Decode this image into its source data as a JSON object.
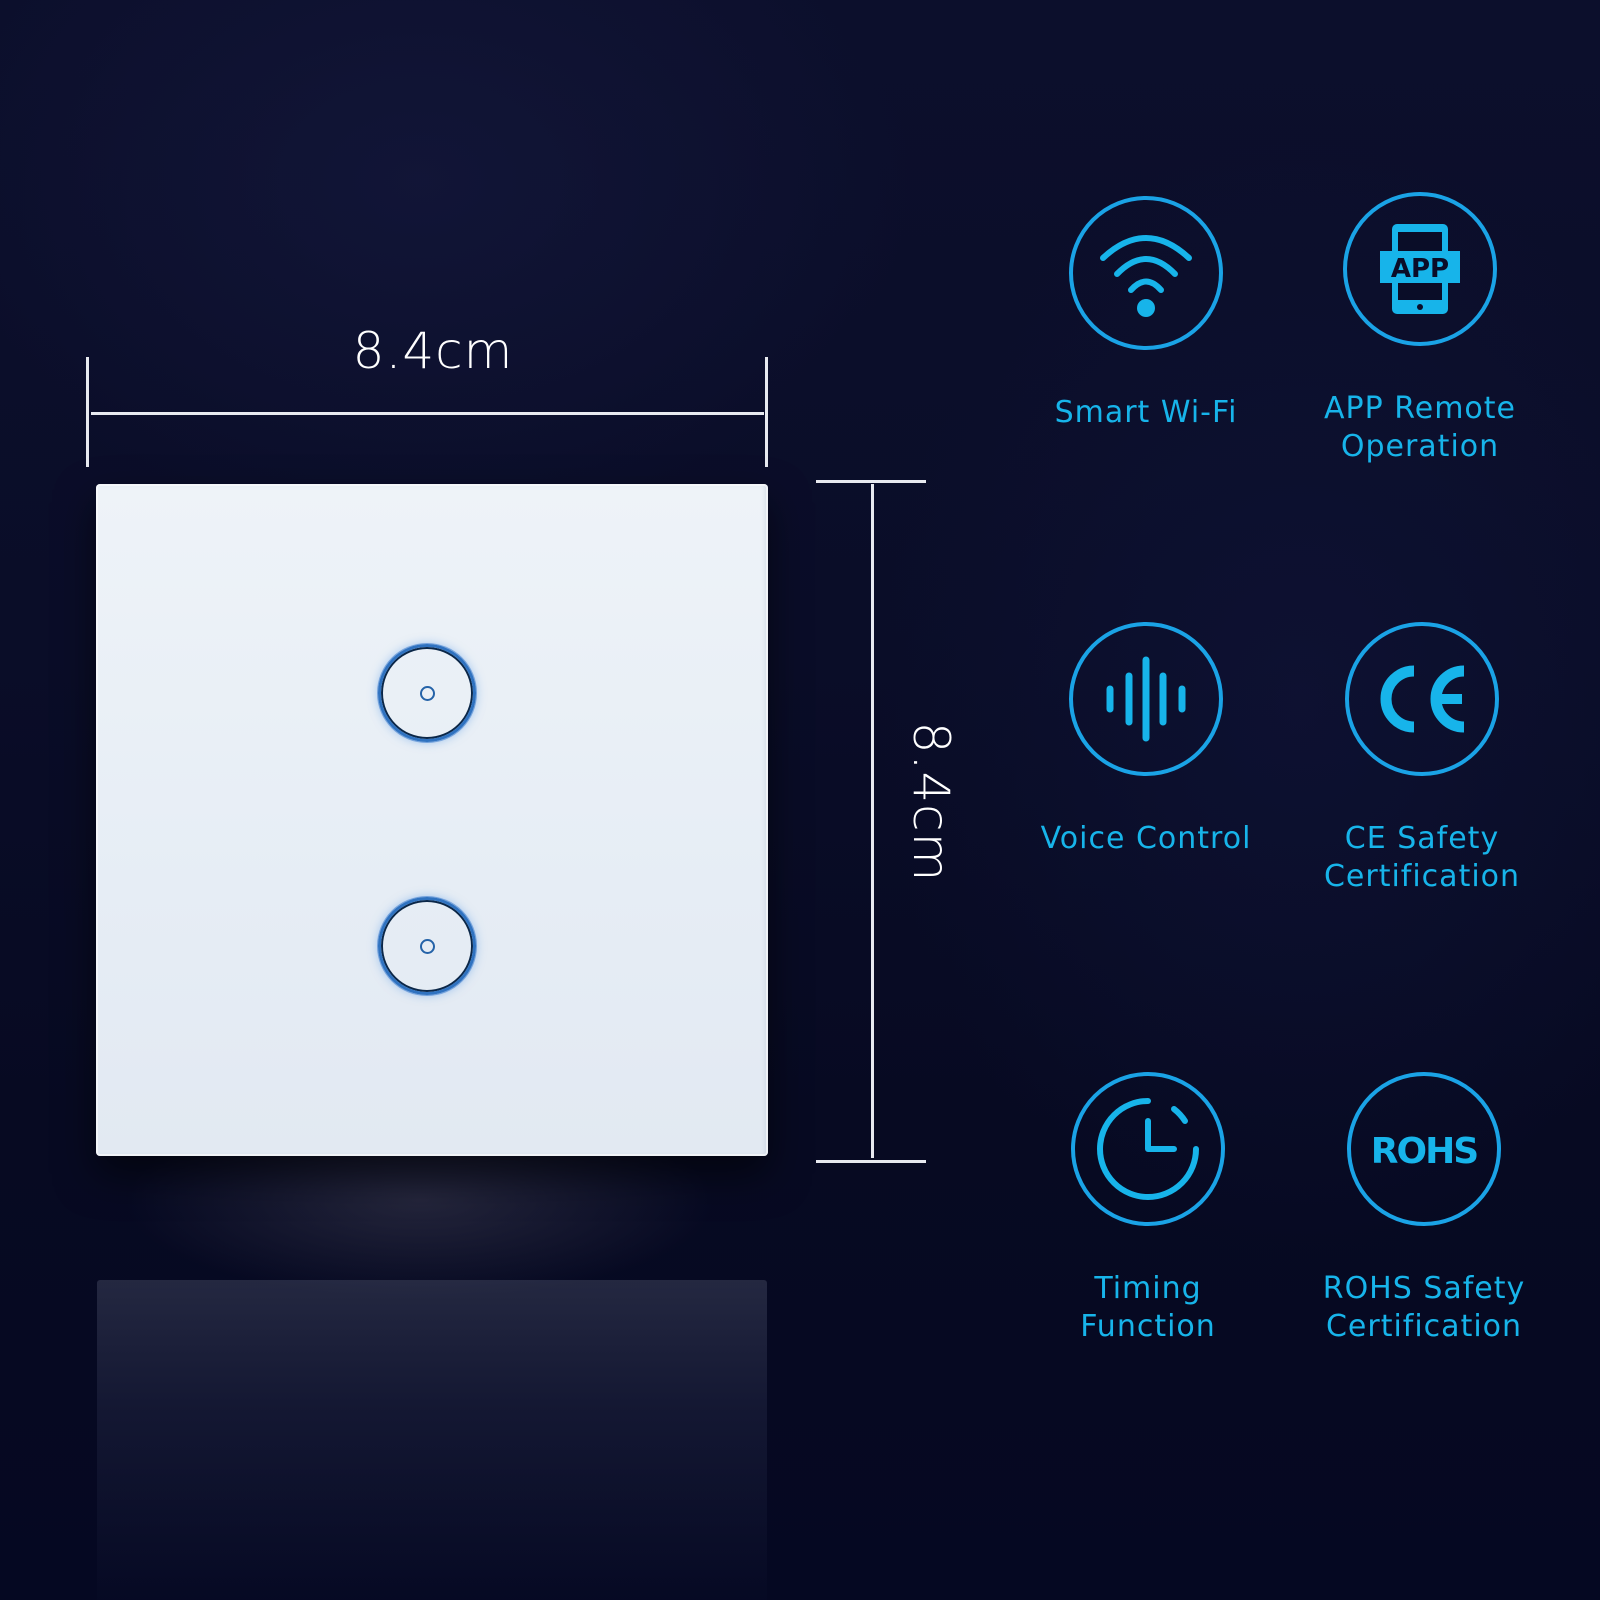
{
  "product": {
    "width_label": "8.4cm",
    "height_label": "8.4cm",
    "buttons": [
      {
        "name": "touch-button-1"
      },
      {
        "name": "touch-button-2"
      }
    ]
  },
  "colors": {
    "accent": "#1aa3e6",
    "label": "#17b4ea",
    "background": "#0a0d28",
    "panel": "#e8eef5",
    "button_ring": "#2f72c0"
  },
  "features": [
    {
      "icon": "wifi-icon",
      "label": "Smart Wi-Fi"
    },
    {
      "icon": "app-icon",
      "label": "APP Remote\nOperation",
      "icon_text": "APP"
    },
    {
      "icon": "voice-waveform-icon",
      "label": "Voice Control"
    },
    {
      "icon": "ce-mark-icon",
      "label": "CE Safety\nCertification",
      "icon_text": "CE"
    },
    {
      "icon": "timer-icon",
      "label": "Timing\nFunction"
    },
    {
      "icon": "rohs-icon",
      "label": "ROHS Safety\nCertification",
      "icon_text": "ROHS"
    }
  ]
}
